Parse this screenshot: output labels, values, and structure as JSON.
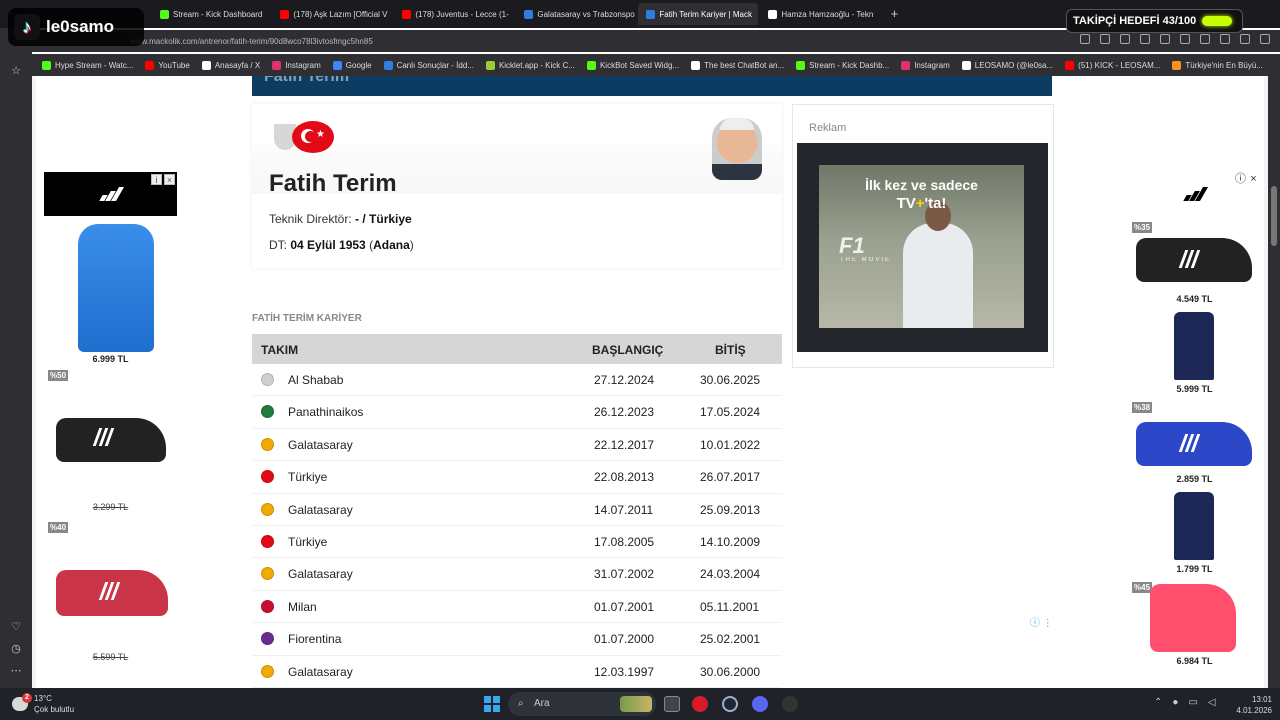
{
  "overlay": {
    "tiktok_name": "le0samo",
    "goal_text": "TAKİPÇİ HEDEFİ 43/100",
    "goal_progress": 0.43
  },
  "browser": {
    "tabs": [
      {
        "label": "Stream - Kick Dashboard",
        "color": "#53fc18",
        "active": false
      },
      {
        "label": "(178) Aşk Lazım [Official V",
        "color": "#ff0000",
        "active": false
      },
      {
        "label": "(178) Juventus - Lecce (1-",
        "color": "#ff0000",
        "active": false
      },
      {
        "label": "Galatasaray vs Trabzonspo",
        "color": "#2f7de1",
        "active": false
      },
      {
        "label": "Fatih Terim Kariyer | Mack",
        "color": "#2f7de1",
        "active": true
      },
      {
        "label": "Hamza Hamzaoğlu - Tekn",
        "color": "#ffffff",
        "active": false
      }
    ],
    "url": "www.mackolik.com/antrenor/fatih-terim/90d8wco78l3ivtosfmgc5hn85",
    "bookmarks": [
      {
        "label": "Hype Stream - Watc...",
        "color": "#53fc18"
      },
      {
        "label": "YouTube",
        "color": "#ff0000"
      },
      {
        "label": "Anasayfa / X",
        "color": "#ffffff"
      },
      {
        "label": "Instagram",
        "color": "#e1306c"
      },
      {
        "label": "Google",
        "color": "#4285f4"
      },
      {
        "label": "Canlı Sonuçlar - İdd...",
        "color": "#2f7de1"
      },
      {
        "label": "Kicklet.app - Kick C...",
        "color": "#9acd32"
      },
      {
        "label": "KickBot Saved Widg...",
        "color": "#53fc18"
      },
      {
        "label": "The best ChatBot an...",
        "color": "#ffffff"
      },
      {
        "label": "Stream - Kick Dashb...",
        "color": "#53fc18"
      },
      {
        "label": "Instagram",
        "color": "#e1306c"
      },
      {
        "label": "LEOSAMO (@le0sa...",
        "color": "#ffffff"
      },
      {
        "label": "(51) KICK - LEOSAM...",
        "color": "#ff0000"
      },
      {
        "label": "Türkiye'nin En Büyü...",
        "color": "#f7931a"
      }
    ]
  },
  "profile": {
    "name": "Fatih Terim",
    "role_label": "Teknik Direktör:",
    "role_value": "- / Türkiye",
    "birth_label": "DT:",
    "birth_date": "04 Eylül 1953",
    "birth_place": "Adana"
  },
  "career": {
    "section_title": "FATİH TERİM KARİYER",
    "headers": {
      "team": "TAKIM",
      "start": "BAŞLANGIÇ",
      "end": "BİTİŞ"
    },
    "rows": [
      {
        "team": "Al Shabab",
        "start": "27.12.2024",
        "end": "30.06.2025",
        "crest": "#d0d0d0"
      },
      {
        "team": "Panathinaikos",
        "start": "26.12.2023",
        "end": "17.05.2024",
        "crest": "#1e7b3a"
      },
      {
        "team": "Galatasaray",
        "start": "22.12.2017",
        "end": "10.01.2022",
        "crest": "#f2a900"
      },
      {
        "team": "Türkiye",
        "start": "22.08.2013",
        "end": "26.07.2017",
        "crest": "#e30a17"
      },
      {
        "team": "Galatasaray",
        "start": "14.07.2011",
        "end": "25.09.2013",
        "crest": "#f2a900"
      },
      {
        "team": "Türkiye",
        "start": "17.08.2005",
        "end": "14.10.2009",
        "crest": "#e30a17"
      },
      {
        "team": "Galatasaray",
        "start": "31.07.2002",
        "end": "24.03.2004",
        "crest": "#f2a900"
      },
      {
        "team": "Milan",
        "start": "01.07.2001",
        "end": "05.11.2001",
        "crest": "#c8102e"
      },
      {
        "team": "Fiorentina",
        "start": "01.07.2000",
        "end": "25.02.2001",
        "crest": "#6b2c91"
      },
      {
        "team": "Galatasaray",
        "start": "12.03.1997",
        "end": "30.06.2000",
        "crest": "#f2a900"
      }
    ]
  },
  "ad_box": {
    "label": "Reklam",
    "headline_1": "İlk kez ve sadece",
    "headline_2_a": "TV",
    "headline_2_b": "+",
    "headline_2_c": "'ta!",
    "logo": "F1",
    "subtitle": "THE MOVIE"
  },
  "left_ad": {
    "items": [
      {
        "price": "6.999 TL",
        "strike": false,
        "discount": ""
      },
      {
        "price": "3.299 TL",
        "strike": true,
        "discount": "%50"
      },
      {
        "price": "5.599 TL",
        "strike": true,
        "discount": "%40"
      }
    ]
  },
  "right_ad": {
    "items": [
      {
        "price": "4.549 TL",
        "discount": "%35"
      },
      {
        "price": "5.999 TL",
        "discount": ""
      },
      {
        "price": "2.859 TL",
        "discount": "%38"
      },
      {
        "price": "1.799 TL",
        "discount": ""
      },
      {
        "price": "6.984 TL",
        "discount": "%45"
      }
    ]
  },
  "taskbar": {
    "temperature": "13°C",
    "weather": "Çok bulutlu",
    "notification_count": "2",
    "search_placeholder": "Ara",
    "time": "13:01",
    "date": "4.01.2026"
  }
}
